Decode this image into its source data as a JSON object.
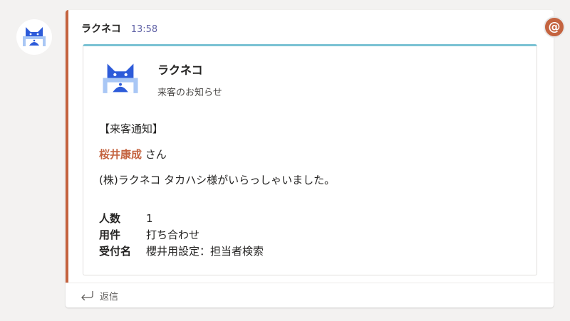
{
  "message": {
    "sender": "ラクネコ",
    "time": "13:58",
    "mention_symbol": "@",
    "reply_label": "返信"
  },
  "card": {
    "title": "ラクネコ",
    "subtitle": "来客のお知らせ",
    "notice": "【来客通知】",
    "person_name": "桜井康成",
    "person_suffix": " さん",
    "body": "(株)ラクネコ タカハシ様がいらっしゃいました。",
    "facts": [
      {
        "label": "人数",
        "value": "1"
      },
      {
        "label": "用件",
        "value": "打ち合わせ"
      },
      {
        "label": "受付名",
        "value": "櫻井用設定：担当者検索"
      }
    ]
  },
  "colors": {
    "accent": "#c4633f",
    "card_top_border": "#7ac2d3",
    "time": "#6264a7",
    "logo_blue": "#2d5bd9",
    "logo_light": "#a9c7f5"
  }
}
